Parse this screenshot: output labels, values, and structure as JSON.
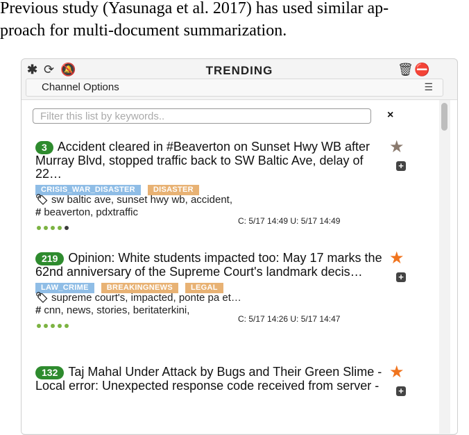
{
  "caption": {
    "line1": "Previous study (Yasunaga et al. 2017) has used similar ap-",
    "line2": "proach for multi-document summarization."
  },
  "panel": {
    "title": "TRENDING",
    "toolbar_icons": [
      "asterisk-icon",
      "refresh-icon",
      "mute-icon",
      "trash-icon",
      "minus-circle-icon"
    ],
    "channel_options": "Channel Options",
    "filter_placeholder": "Filter this list by keywords..",
    "filter_value": "",
    "clear_symbol": "×"
  },
  "items": [
    {
      "count": "3",
      "headline": "Accident cleared in #Beaverton on Sunset Hwy WB after Murray Blvd, stopped traffic back to SW Baltic Ave, delay of 22…",
      "starred": false,
      "tags": [
        {
          "label": "CRISIS_WAR_DISASTER",
          "color": "#8fbde6"
        },
        {
          "label": "DISASTER",
          "color": "#e8b274"
        }
      ],
      "keywords": "sw baltic ave, sunset hwy wb, accident,",
      "hashtags": "beaverton, pdxtraffic",
      "dates": "C: 5/17 14:49 U: 5/17 14:49",
      "dots_green": 4,
      "dots_dark": 1
    },
    {
      "count": "219",
      "headline": "Opinion: White students impacted too: May 17 marks the 62nd anniversary of the Supreme Court's landmark decis…",
      "starred": true,
      "tags": [
        {
          "label": "LAW_CRIME",
          "color": "#8fbde6"
        },
        {
          "label": "BREAKINGNEWS",
          "color": "#e8b274"
        },
        {
          "label": "LEGAL",
          "color": "#e8b274"
        }
      ],
      "keywords": "supreme court's, impacted, ponte pa et…",
      "hashtags": "cnn, news, stories, beritaterkini,",
      "dates": "C: 5/17 14:26 U: 5/17 14:47",
      "dots_green": 5,
      "dots_dark": 0
    },
    {
      "count": "132",
      "headline": "Taj Mahal Under Attack by Bugs and Their Green Slime - Local error: Unexpected response code received from server -",
      "starred": true,
      "tags": [],
      "keywords": "",
      "hashtags": "",
      "dates": "",
      "dots_green": 0,
      "dots_dark": 0
    }
  ],
  "colors": {
    "count_badge": "#2e8b2e",
    "star_active": "#f0741e",
    "star_inactive": "#8a7a6e",
    "dot_green": "#7cb342"
  }
}
